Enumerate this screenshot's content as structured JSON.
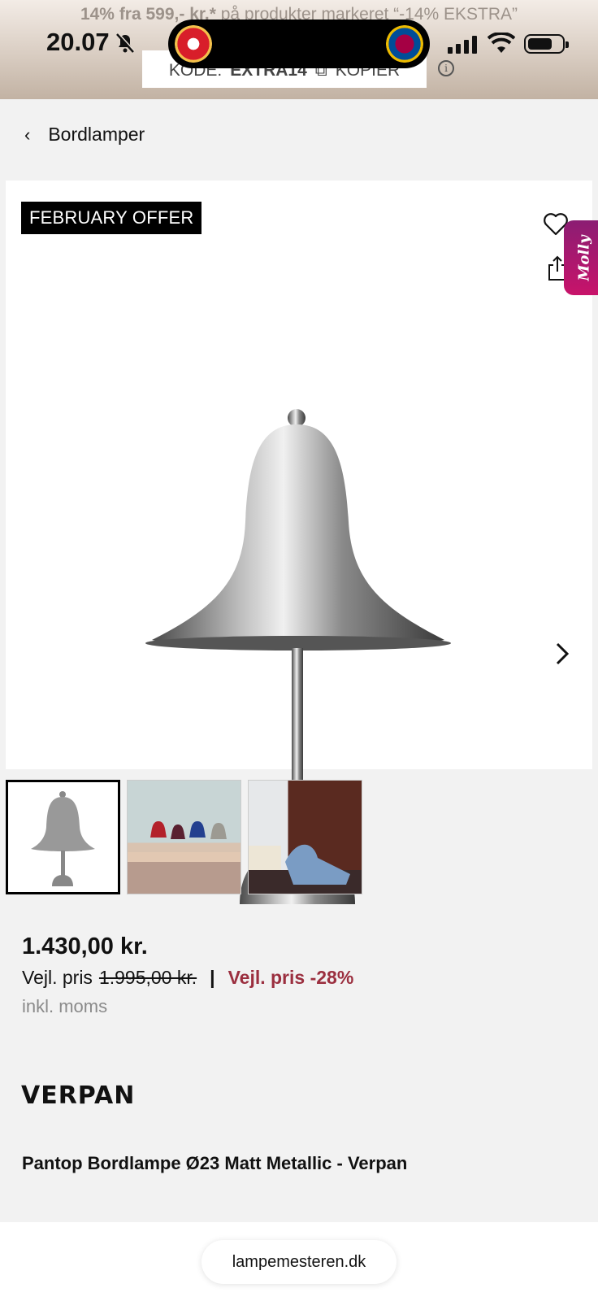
{
  "status_bar": {
    "time": "20.07",
    "bell_icon": "bell-slash-icon",
    "signal_icon": "cellular-signal-icon",
    "wifi_icon": "wifi-icon",
    "battery_level": 0.75
  },
  "promo": {
    "text_bold": "14% fra 599,- kr.*",
    "text_rest": " på produkter markeret “-14% EKSTRA”",
    "code_label": "KODE:",
    "code_value": "EXTRA14",
    "copy_label": "KOPIER",
    "info_icon_glyph": "i"
  },
  "breadcrumb": {
    "back_glyph": "‹",
    "label": "Bordlamper"
  },
  "product": {
    "badge": "FEBRUARY OFFER",
    "side_tab": "Molly",
    "price": "1.430,00 kr.",
    "rrp_label": "Vejl. pris",
    "rrp_value": "1.995,00 kr.",
    "separator": "|",
    "discount_label": "Vejl. pris -28%",
    "vat_note": "inkl. moms",
    "brand": "VERPAN",
    "title": "Pantop Bordlampe Ø23 Matt Metallic - Verpan"
  },
  "browser": {
    "url": "lampemesteren.dk"
  },
  "colors": {
    "discount": "#9b2f3f",
    "badge_bg": "#000000",
    "molly_tab": "#b0136c"
  }
}
